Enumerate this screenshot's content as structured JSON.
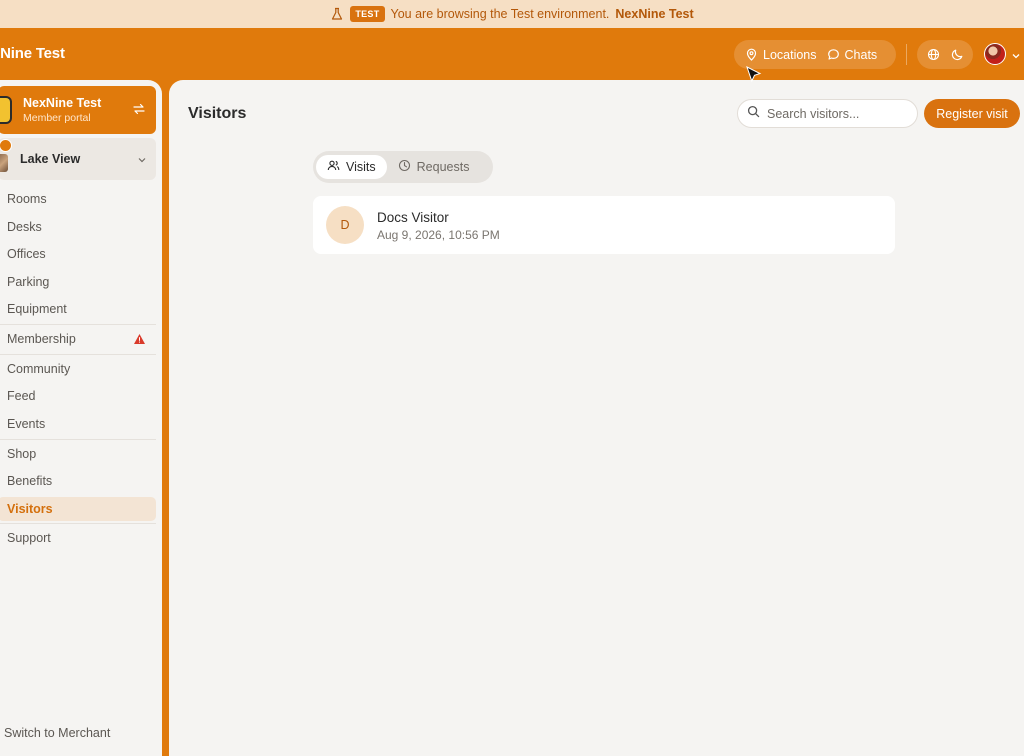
{
  "banner": {
    "tag": "TEST",
    "message": "You are browsing the Test environment.",
    "env_name": "NexNine Test"
  },
  "topbar": {
    "brand": "xNine Test",
    "locations_label": "Locations",
    "chats_label": "Chats",
    "icons": [
      "map-pin-icon",
      "chat-bubble-icon",
      "globe-icon",
      "moon-icon",
      "chevron-down-icon"
    ]
  },
  "sidebar": {
    "org": {
      "name": "NexNine Test",
      "subtitle": "Member portal"
    },
    "location": {
      "name": "Lake View"
    },
    "items": [
      {
        "label": "Rooms"
      },
      {
        "label": "Desks"
      },
      {
        "label": "Offices"
      },
      {
        "label": "Parking"
      },
      {
        "label": "Equipment"
      },
      {
        "label": "Membership",
        "warning": true
      },
      {
        "label": "Community"
      },
      {
        "label": "Feed"
      },
      {
        "label": "Events"
      },
      {
        "label": "Shop"
      },
      {
        "label": "Benefits"
      },
      {
        "label": "Visitors",
        "active": true
      },
      {
        "label": "Support"
      }
    ],
    "footer_link": "Switch to Merchant"
  },
  "main": {
    "title": "Visitors",
    "search_placeholder": "Search visitors...",
    "register_label": "Register visit",
    "tabs": [
      {
        "label": "Visits",
        "active": true
      },
      {
        "label": "Requests",
        "active": false
      }
    ],
    "visits": [
      {
        "initial": "D",
        "name": "Docs Visitor",
        "datetime": "Aug 9, 2026, 10:56 PM"
      }
    ]
  },
  "colors": {
    "brand": "#e07a0c",
    "banner_bg": "#f6dfc4",
    "surface": "#f5f4f2",
    "active_text": "#d4700d",
    "warning": "#d93a2b"
  }
}
